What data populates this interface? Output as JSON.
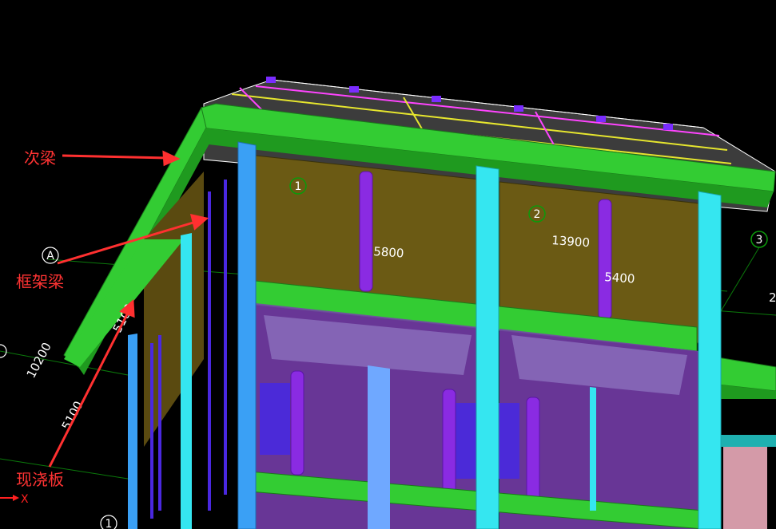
{
  "model": {
    "grid_axes": [
      "1",
      "2",
      "3",
      "A",
      "1"
    ],
    "dimensions": [
      "5800",
      "13900",
      "5400",
      "10200",
      "5100",
      "5100",
      "2"
    ],
    "callouts": {
      "secondary_beam": "次梁",
      "frame_beam": "框架梁",
      "cast_slab": "现浇板"
    },
    "ucs_x_label": "X"
  },
  "colors": {
    "background": "#000000",
    "beam": "#2ecc2e",
    "beam_dark": "#1f9a1f",
    "column": "#35e6f0",
    "column_blue": "#3aa0f5",
    "wall_panel": "#6b5a14",
    "window_panel": "#7a3fb0",
    "rebar": "#8a2be2",
    "annotation": "#ff3333"
  }
}
